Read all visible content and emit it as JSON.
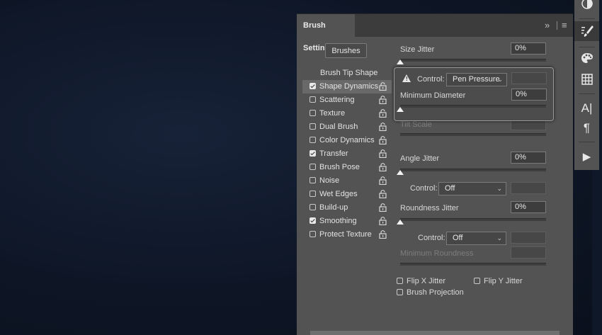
{
  "panel": {
    "title": "Brush Settings",
    "header_icons": [
      "expand-icon",
      "panel-menu-icon"
    ],
    "expand_glyph": "»",
    "menu_glyph": "≡",
    "brushes_button": "Brushes",
    "list": [
      {
        "label": "Brush Tip Shape",
        "checkbox": false,
        "lock": false,
        "selected": false
      },
      {
        "label": "Shape Dynamics",
        "checked": true,
        "lock": true,
        "selected": true
      },
      {
        "label": "Scattering",
        "checked": false,
        "lock": true
      },
      {
        "label": "Texture",
        "checked": false,
        "lock": true
      },
      {
        "label": "Dual Brush",
        "checked": false,
        "lock": true
      },
      {
        "label": "Color Dynamics",
        "checked": false,
        "lock": true
      },
      {
        "label": "Transfer",
        "checked": true,
        "lock": true
      },
      {
        "label": "Brush Pose",
        "checked": false,
        "lock": true
      },
      {
        "label": "Noise",
        "checked": false,
        "lock": true
      },
      {
        "label": "Wet Edges",
        "checked": false,
        "lock": true
      },
      {
        "label": "Build-up",
        "checked": false,
        "lock": true
      },
      {
        "label": "Smoothing",
        "checked": true,
        "lock": true
      },
      {
        "label": "Protect Texture",
        "checked": false,
        "lock": true
      }
    ],
    "size_jitter": {
      "label": "Size Jitter",
      "value": "0%"
    },
    "popup": {
      "control_label": "Control:",
      "control_value": "Pen Pressure",
      "min_diameter_label": "Minimum Diameter",
      "min_diameter_value": "0%"
    },
    "tilt_scale": {
      "label": "Tilt Scale"
    },
    "angle_jitter": {
      "label": "Angle Jitter",
      "value": "0%",
      "control_label": "Control:",
      "control_value": "Off"
    },
    "roundness_jitter": {
      "label": "Roundness Jitter",
      "value": "0%",
      "control_label": "Control:",
      "control_value": "Off"
    },
    "minimum_roundness": {
      "label": "Minimum Roundness"
    },
    "flip_x": "Flip X Jitter",
    "flip_y": "Flip Y Jitter",
    "brush_projection": "Brush Projection"
  },
  "toolbar": {
    "icons": [
      "adjustments-icon",
      "brush-settings-icon",
      "color-palette-icon",
      "grid-table-icon",
      "character-icon",
      "paragraph-icon",
      "play-actions-icon"
    ],
    "character_glyph": "A|",
    "paragraph_glyph": "¶",
    "play_glyph": "▶"
  },
  "colors": {
    "panel": "#535353",
    "header": "#3c3c3c",
    "accent": "#e6e6e6"
  }
}
